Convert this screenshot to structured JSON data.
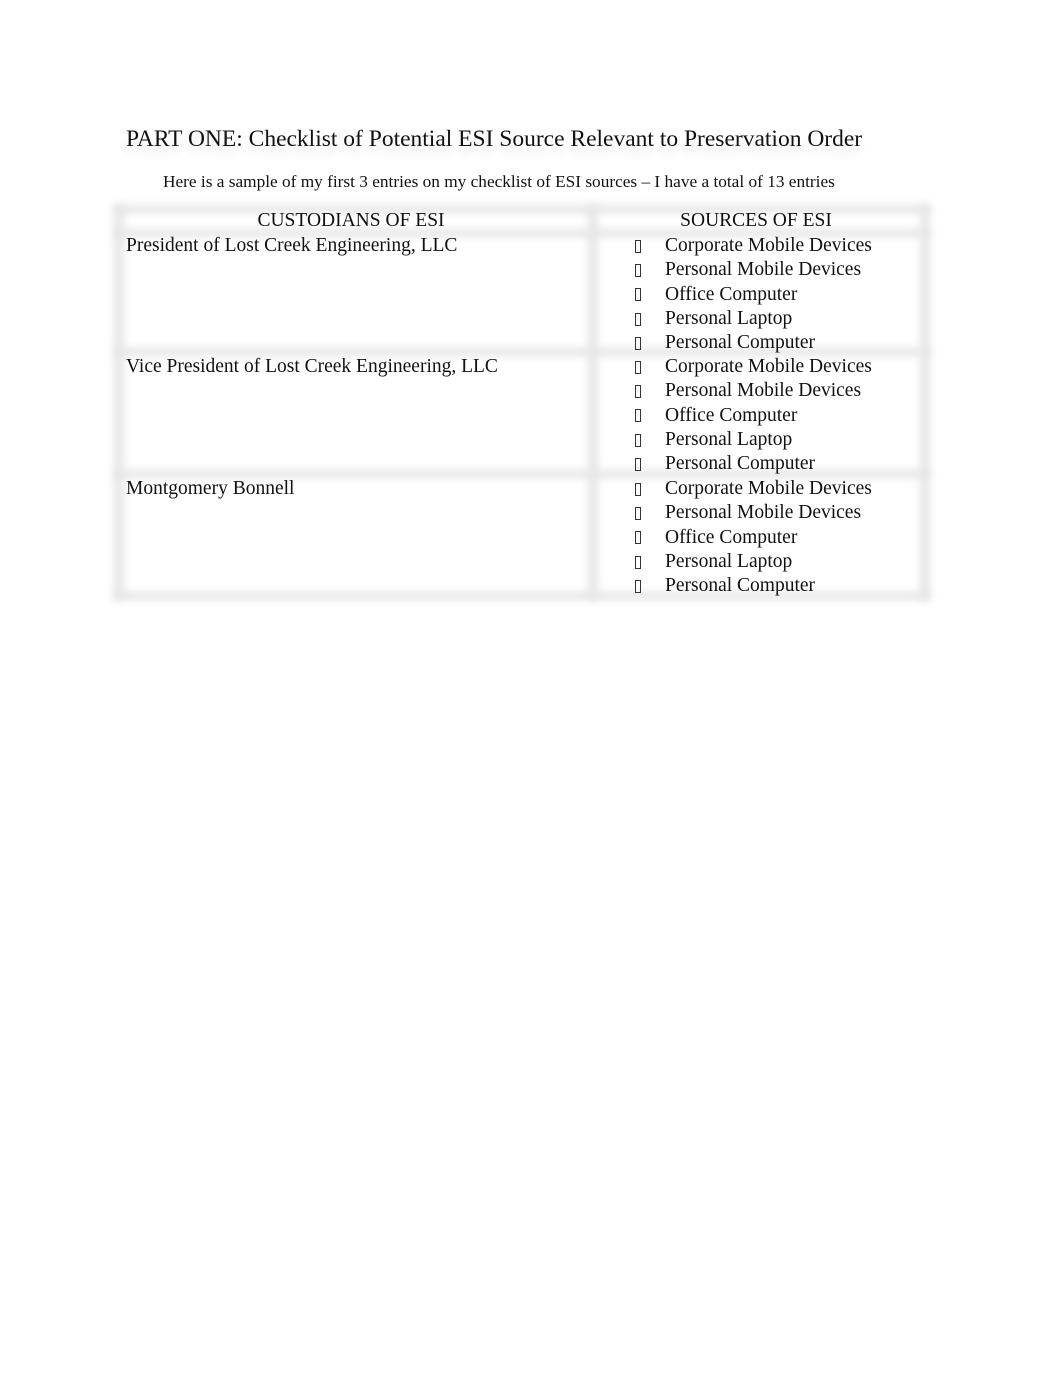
{
  "document": {
    "title": "PART ONE: Checklist of Potential ESI Source Relevant to Preservation Order",
    "subtitle": "Here is a sample of my first 3 entries on my checklist of ESI sources – I have a total of 13 entries"
  },
  "table": {
    "headers": {
      "custodians": "CUSTODIANS OF ESI",
      "sources": "SOURCES OF ESI"
    },
    "bullet_icon": "missing-glyph-box",
    "rows": [
      {
        "custodian": "President of Lost Creek Engineering, LLC",
        "sources": [
          "Corporate Mobile Devices",
          "Personal Mobile Devices",
          "Office Computer",
          "Personal Laptop",
          "Personal Computer"
        ]
      },
      {
        "custodian": "Vice President of Lost Creek Engineering, LLC",
        "sources": [
          "Corporate Mobile Devices",
          "Personal Mobile Devices",
          "Office Computer",
          "Personal Laptop",
          "Personal Computer"
        ]
      },
      {
        "custodian": "Montgomery Bonnell",
        "sources": [
          "Corporate Mobile Devices",
          "Personal Mobile Devices",
          "Office Computer",
          "Personal Laptop",
          "Personal Computer"
        ]
      }
    ]
  }
}
